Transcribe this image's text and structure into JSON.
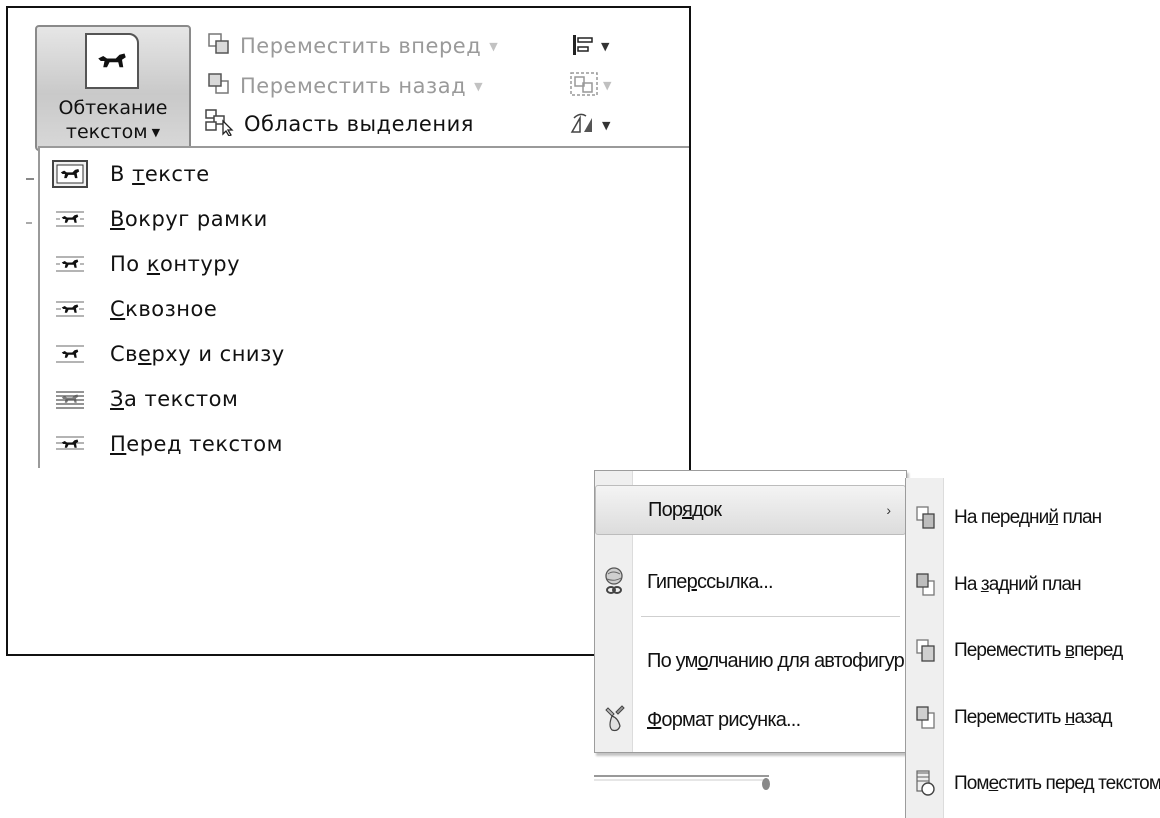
{
  "ribbon": {
    "wrap_button": {
      "line1": "Обтекание",
      "line2": "текстом",
      "arrow": "▼",
      "icon": "wrap-text-dog-icon"
    },
    "bring_forward": {
      "label": "Переместить вперед",
      "icon": "bring-forward-icon",
      "disabled": true
    },
    "send_backward": {
      "label": "Переместить назад",
      "icon": "send-backward-icon",
      "disabled": true
    },
    "selection_pane": {
      "label": "Область выделения",
      "icon": "selection-pane-icon"
    },
    "tools": [
      {
        "icon": "align-icon",
        "arrow": "▼"
      },
      {
        "icon": "group-icon",
        "arrow": "▼"
      },
      {
        "icon": "rotate-icon",
        "arrow": "▼"
      }
    ]
  },
  "wrap_menu": {
    "items": [
      {
        "pre": "В ",
        "u": "т",
        "post": "ексте",
        "icon": "inline-with-text-icon",
        "selected": true
      },
      {
        "pre": "",
        "u": "В",
        "post": "округ рамки",
        "icon": "square-wrap-icon"
      },
      {
        "pre": "По ",
        "u": "к",
        "post": "онтуру",
        "icon": "tight-wrap-icon"
      },
      {
        "pre": "",
        "u": "С",
        "post": "квозное",
        "icon": "through-wrap-icon"
      },
      {
        "pre": "Св",
        "u": "е",
        "post": "рху и снизу",
        "icon": "top-bottom-wrap-icon"
      },
      {
        "pre": "",
        "u": "З",
        "post": "а текстом",
        "icon": "behind-text-icon"
      },
      {
        "pre": "",
        "u": "П",
        "post": "еред текстом",
        "icon": "in-front-of-text-icon"
      }
    ]
  },
  "context_menu": {
    "items": [
      {
        "pre": "Пор",
        "u": "я",
        "post": "док",
        "icon": "",
        "submenu": true,
        "highlighted": true
      },
      {
        "pre": "Гипе",
        "u": "р",
        "post": "ссылка...",
        "icon": "hyperlink-globe-icon"
      },
      {
        "pre": "По ум",
        "u": "о",
        "post": "лчанию для автофигур",
        "icon": ""
      },
      {
        "pre": "",
        "u": "Ф",
        "post": "ормат рисунка...",
        "icon": "format-picture-icon"
      }
    ],
    "submenu_arrow": "›"
  },
  "order_submenu": {
    "items": [
      {
        "pre": "На передни",
        "u": "й",
        "post": " план",
        "icon": "bring-to-front-icon"
      },
      {
        "pre": "На ",
        "u": "з",
        "post": "адний план",
        "icon": "send-to-back-icon"
      },
      {
        "pre": "Переместить ",
        "u": "в",
        "post": "перед",
        "icon": "bring-forward-icon"
      },
      {
        "pre": "Переместить ",
        "u": "н",
        "post": "азад",
        "icon": "send-backward-icon"
      },
      {
        "pre": "Пом",
        "u": "е",
        "post": "стить перед текстом",
        "icon": "bring-in-front-of-text-icon"
      }
    ]
  }
}
